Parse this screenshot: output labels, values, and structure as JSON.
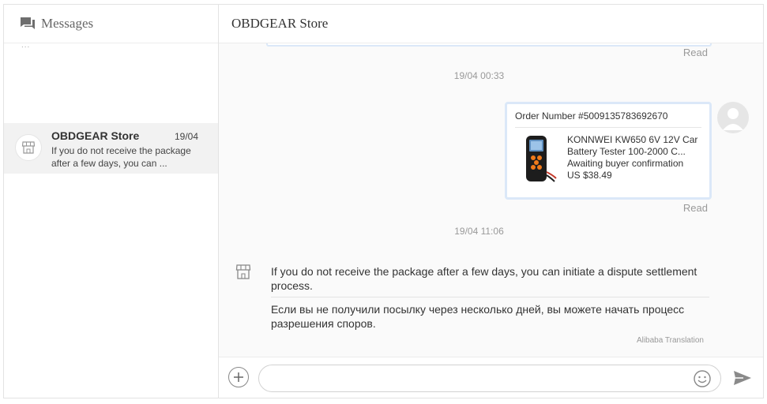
{
  "sidebar": {
    "title": "Messages",
    "top_fragment": "...",
    "bottom_fragment": "... ... .. .. . ..",
    "conversations": [
      {
        "name": "OBDGEAR Store",
        "date": "19/04",
        "preview": "If you do not receive the package after a few days, you can ..."
      }
    ]
  },
  "chat": {
    "title": "OBDGEAR Store",
    "read_label_1": "Read",
    "timestamp_1": "19/04 00:33",
    "order": {
      "number_label": "Order Number #5009135783692670",
      "product_name": "KONNWEI KW650 6V 12V Car Battery Tester 100-2000 C...",
      "status": "Awaiting buyer confirmation",
      "price": "US $38.49"
    },
    "read_label_2": "Read",
    "timestamp_2": "19/04 11:06",
    "incoming_message": {
      "text": "If you do not receive the package after a few days, you can initiate a dispute settlement process.",
      "translation": "Если вы не получили посылку через несколько дней, вы можете начать процесс разрешения споров.",
      "translation_source": "Alibaba Translation"
    }
  },
  "input": {
    "placeholder": ""
  },
  "colors": {
    "card_border": "#dbe8f8",
    "sidebar_selected": "#f2f2f2",
    "chat_background": "#fafafa"
  }
}
